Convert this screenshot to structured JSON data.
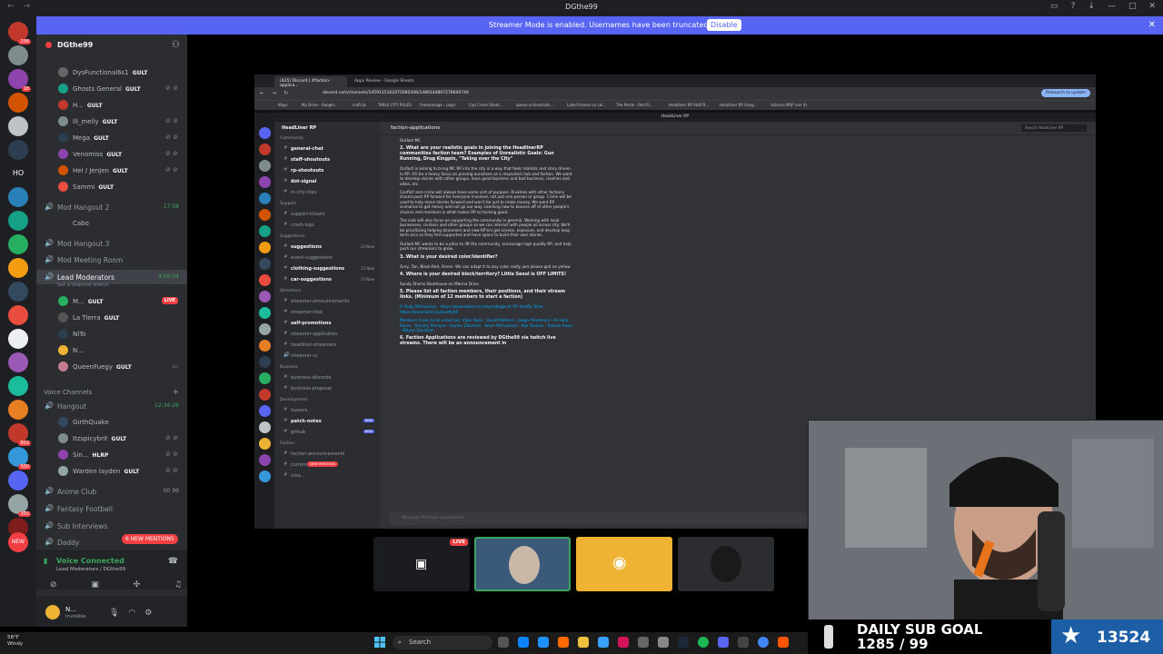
{
  "window": {
    "title": "DGthe99"
  },
  "banner": {
    "message": "Streamer Mode is enabled. Usernames have been truncated.",
    "button": "Disable"
  },
  "rail": {
    "badges": [
      "206",
      "18",
      "HO",
      "802",
      "500",
      "355",
      "NEW"
    ]
  },
  "server": {
    "name": "DGthe99"
  },
  "sidebar": {
    "top_members": [
      {
        "name": "DysFunctional6s1",
        "tag": "GULT"
      },
      {
        "name": "Ghosts General",
        "tag": "GULT"
      },
      {
        "name": "H...",
        "tag": "GULT"
      },
      {
        "name": "Ill_melly",
        "tag": "GULT"
      },
      {
        "name": "Mega",
        "tag": "GULT"
      },
      {
        "name": "Venomiss",
        "tag": "GULT"
      },
      {
        "name": "Hel / JenJen",
        "tag": "GULT"
      },
      {
        "name": "Sammi",
        "tag": "GULT"
      }
    ],
    "hangout2": {
      "name": "Mod Hangout 2",
      "time": "17:58"
    },
    "cabo": "Cabo",
    "hangout3": "Mod Hangout 3",
    "meeting": "Mod Meeting Room",
    "lead": {
      "name": "Lead Moderators",
      "time": "4:56:34",
      "status": "Set a channel status"
    },
    "lead_members": [
      {
        "name": "M...",
        "tag": "GULT",
        "live": "LIVE"
      },
      {
        "name": "La Tierra",
        "tag": "GULT"
      },
      {
        "name": "NiTo",
        "tag": ""
      },
      {
        "name": "N...",
        "tag": ""
      },
      {
        "name": "QueenFuegy",
        "tag": "GULT"
      }
    ],
    "voice_category": "Voice Channels",
    "hangout": {
      "name": "Hangout",
      "time": "12:34:26"
    },
    "hangout_members": [
      {
        "name": "GirthQuake",
        "tag": ""
      },
      {
        "name": "Itzspicybrit",
        "tag": "GULT"
      },
      {
        "name": "Sin...",
        "tag": "HLRP"
      },
      {
        "name": "Warden layden",
        "tag": "GULT"
      }
    ],
    "anime": {
      "name": "Anime Club",
      "count": "00 99"
    },
    "fantasy": "Fantasy Football",
    "interviews": "Sub Interviews",
    "daddy": "Daddy",
    "mentions": "6 NEW MENTIONS"
  },
  "voice": {
    "status": "Voice Connected",
    "channel": "Lead Moderators / DGthe99"
  },
  "user": {
    "name": "N...",
    "status": "Invisible"
  },
  "shared": {
    "tabs": [
      "(425) Discord | #faction-applica...",
      "Apps Review - Google Sheets"
    ],
    "url": "discord.com/channels/1459115162075060206/1489144807276600744",
    "relaunch": "Relaunch to update",
    "bookmarks": [
      "Maps",
      "My Drive - Google...",
      "sraft.tjs",
      "TABLE CITY RULES",
      "Freemanage - Login",
      "Cop Crime Sheet...",
      "queue.onlinestrats...",
      "Label frames on col...",
      "The Portal - Red Ri...",
      "Headliner RP Staff R...",
      "Headliner RP Gang...",
      "Vulcana MSP (ver 4)"
    ],
    "topline": "HeadLiner RP",
    "server_name": "HeadLiner RP",
    "channel": "faction-applications",
    "search": "Search HeadLiner RP",
    "categories": [
      "Community",
      "Support",
      "Suggestions",
      "Streamers",
      "Business",
      "Development",
      "Faction"
    ],
    "channels": {
      "community": [
        "general-chat",
        "staff-shoutouts",
        "rp-shoutouts",
        "dot-signal",
        "in-city-clips"
      ],
      "support": [
        "support-tickets",
        "crash-logs"
      ],
      "suggestions": [
        "suggestions",
        "event-suggestions",
        "clothing-suggestions",
        "car-suggestions"
      ],
      "streamers": [
        "streamer-announcements",
        "streamer-chat",
        "self-promotions",
        "streamer-application",
        "headliner-streamers",
        "streamer vc"
      ],
      "business": [
        "business-discords",
        "business-proposal"
      ],
      "development": [
        "teasers",
        "patch-notes",
        "github"
      ],
      "faction": [
        "faction-announcements",
        "current-factions",
        "crea..."
      ]
    },
    "counts": {
      "suggestions": "23 New",
      "clothing": "12 New",
      "car": "14 New",
      "patch": "NEW",
      "github": "NEW"
    },
    "inner_mentions": "NEW MENTIONS",
    "composer": "Message #faction-applications",
    "messages": [
      {
        "q": false,
        "t": "Outlast MC"
      },
      {
        "q": true,
        "t": "2. What are your realistic goals in joining the HeadlinerRP communities faction team? Examples of Unrealistic Goals: Gun Running, Drug Kingpin, \"Taking over the City\""
      },
      {
        "q": false,
        "t": "Outlast is aiming to bring MC RP into the city in a way that feels realistic and story driven. In RP, it'll be a heavy focus on proving ourselves as a respected club and faction. We want to develop stories with other groups, have good business and bad business, rivalries and allies, etc."
      },
      {
        "q": false,
        "t": "Conflict and crime will always have some sort of purpose. Rivalries with other factions should push RP forward for everyone involved, not just one person or group. Crime will be used to help move stories forward and won't be just to make money. We want RP scenarios to get messy and not go our way. Learning how to bounce off of other people's choices and reactions is what makes RP so fucking good."
      },
      {
        "q": false,
        "t": "The club will also focus on supporting the community in general. Working with local businesses, civilians and other groups so we can interact with people all across city. We'll be prioritizing helping streamers and new RP'ers get scenes, exposure, and develop long term arcs so they feel supported and have space to build their own stories."
      },
      {
        "q": false,
        "t": "Outlast MC wants to be a pillar to lift the community, encourage high quality RP, and help push our streamers to grow."
      },
      {
        "q": true,
        "t": "3. What is your desired color/identifier?"
      },
      {
        "q": false,
        "t": "Grey, Tan, Black-Red, Green. We can adapt it to any color really just please god no yellow"
      },
      {
        "q": true,
        "t": "4. Where is your desired block/territory? Little Seoul is OFF LIMITS!"
      },
      {
        "q": false,
        "t": "Sandy Shores Boathouse on Marina Drive"
      },
      {
        "q": true,
        "t": "5. Please list all faction members, their positions, and their stream links. (Minimum of 12 members to start a faction)"
      },
      {
        "q": false,
        "t": "P: Ruby Michaelson - https://www.twitch.tv/rubyredbigbuilt  VP: Kneffy Tailor - https://www.twitch.tv/kneffy95",
        "link": true
      },
      {
        "q": false,
        "t": "Members (roles to be voted on): Viper Ryan - David Mathers - Jaeger Pentecost - Arcadia Rosso - Sammy Siempre - Hunter Zolomon - Kevin Michaelson - Rez Hudson - Roscoe Rossi - Wayne Davidson",
        "link": true
      },
      {
        "q": true,
        "t": "6. Faction Applications are reviewed by DGthe99 via twitch live streams. There will be an announcement in"
      }
    ]
  },
  "tiles": {
    "live": "LIVE"
  },
  "subgoal": {
    "label_line1": "DAILY SUB GOAL",
    "label_line2": "1285 / 99",
    "count": "13524"
  },
  "taskbar": {
    "temp": "58°F",
    "condition": "Windy",
    "search": "Search"
  }
}
